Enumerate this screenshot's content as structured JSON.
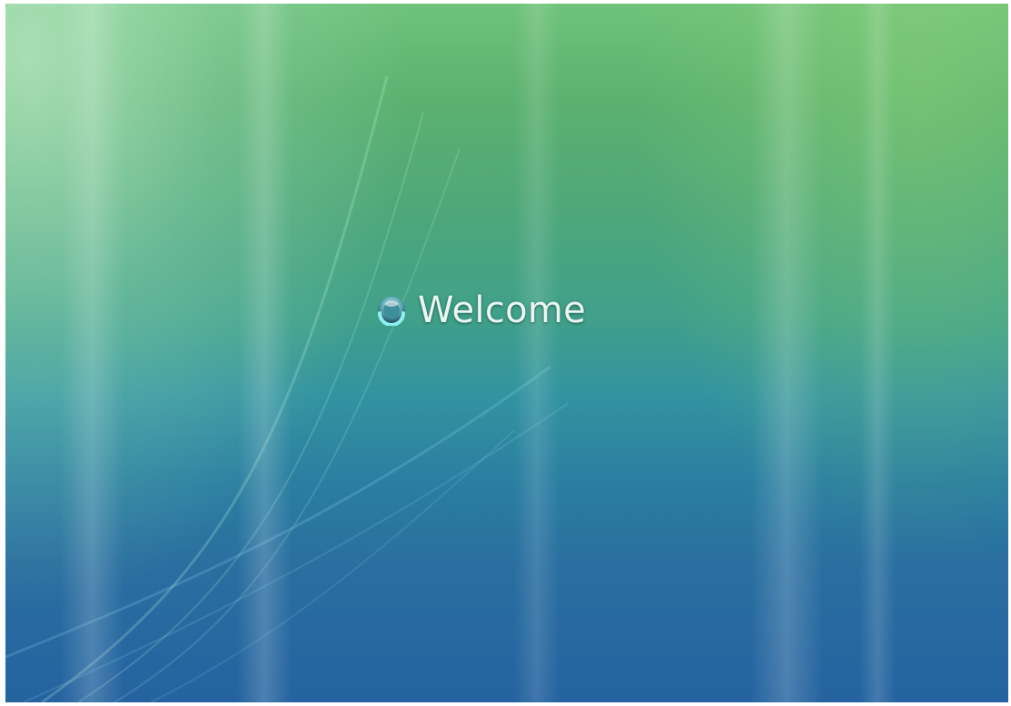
{
  "screen": {
    "welcome_text": "Welcome",
    "spinner_icon": "busy-spinner-icon"
  },
  "colors": {
    "top": "#6fc27a",
    "middle": "#3393a0",
    "bottom": "#2563a0",
    "text": "#eaf6f0"
  }
}
